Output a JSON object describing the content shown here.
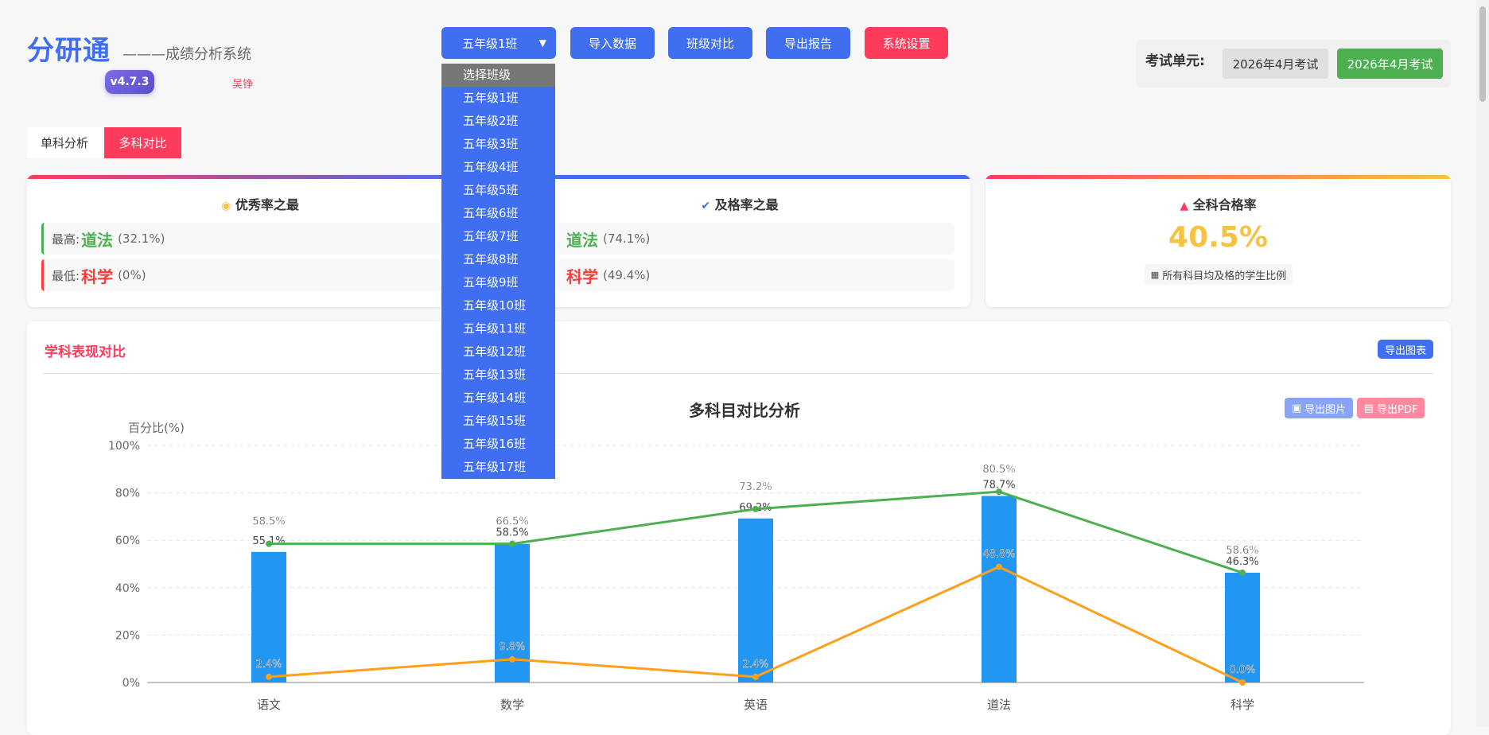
{
  "app": {
    "logo": "分研通",
    "subtitle": "———成绩分析系统",
    "version": "v4.7.3",
    "author": "吴铮"
  },
  "toolbar": {
    "class_selected": "五年级1班",
    "import_label": "导入数据",
    "compare_label": "班级对比",
    "export_label": "导出报告",
    "settings_label": "系统设置"
  },
  "class_dropdown": {
    "header": "选择班级",
    "options": [
      "五年级1班",
      "五年级2班",
      "五年级3班",
      "五年级4班",
      "五年级5班",
      "五年级6班",
      "五年级7班",
      "五年级8班",
      "五年级9班",
      "五年级10班",
      "五年级11班",
      "五年级12班",
      "五年级13班",
      "五年级14班",
      "五年级15班",
      "五年级16班",
      "五年级17班"
    ]
  },
  "exam": {
    "label": "考试单元:",
    "options": [
      "2026年4月考试",
      "2026年4月考试"
    ]
  },
  "tabs": [
    "单科分析",
    "多科对比"
  ],
  "cards": {
    "excellent": {
      "title": "优秀率之最",
      "high_label": "最高:",
      "high_subject": "道法",
      "high_value": "(32.1%)",
      "low_label": "最低:",
      "low_subject": "科学",
      "low_value": "(0%)"
    },
    "pass": {
      "title": "及格率之最",
      "high_subject": "道法",
      "high_value": "(74.1%)",
      "low_subject": "科学",
      "low_value": "(49.4%)"
    },
    "all_pass": {
      "title": "全科合格率",
      "value": "40.5%",
      "note": "所有科目均及格的学生比例"
    }
  },
  "panel": {
    "title": "学科表现对比",
    "export_chart": "导出图表",
    "export_image": "导出图片",
    "export_pdf": "导出PDF"
  },
  "colors": {
    "primary": "#3f6ff0",
    "danger": "#ff3b5c",
    "success": "#4caf50",
    "bar": "#2196f3",
    "line_green": "#4caf50",
    "line_orange": "#ff9f1a",
    "all_pass": "#f5c242"
  },
  "chart_data": {
    "type": "bar",
    "title": "多科目对比分析",
    "ylabel": "百分比(%)",
    "ylim": [
      0,
      100
    ],
    "yticks": [
      "0%",
      "20%",
      "40%",
      "60%",
      "80%",
      "100%"
    ],
    "categories": [
      "语文",
      "数学",
      "英语",
      "道法",
      "科学"
    ],
    "grid": true,
    "series": [
      {
        "type": "bar",
        "values": [
          55.1,
          58.5,
          69.2,
          78.7,
          46.3
        ],
        "labels": [
          "55.1%",
          "58.5%",
          "69.2%",
          "78.7%",
          "46.3%"
        ]
      },
      {
        "type": "line",
        "values": [
          58.5,
          58.5,
          73.2,
          80.5,
          46.3
        ],
        "labels": [
          "58.5%",
          "66.5%",
          "73.2%",
          "80.5%",
          "58.6%"
        ]
      },
      {
        "type": "line",
        "values": [
          2.4,
          9.8,
          2.4,
          48.8,
          0.0
        ],
        "labels": [
          "2.4%",
          "9.8%",
          "2.4%",
          "48.8%",
          "0.0%"
        ]
      }
    ]
  }
}
